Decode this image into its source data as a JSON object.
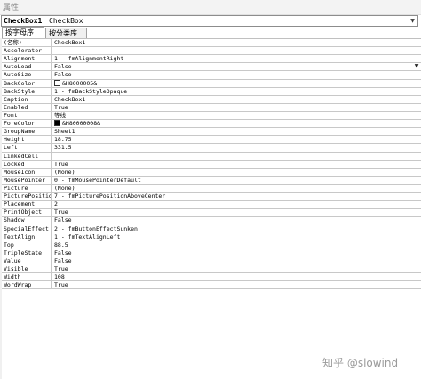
{
  "window": {
    "title": "属性"
  },
  "object_selector": {
    "name": "CheckBox1",
    "type": "CheckBox"
  },
  "tabs": [
    {
      "label": "按字母序",
      "active": true
    },
    {
      "label": "按分类序",
      "active": false
    }
  ],
  "properties": [
    {
      "name": "(名称)",
      "value": "CheckBox1"
    },
    {
      "name": "Accelerator",
      "value": ""
    },
    {
      "name": "Alignment",
      "value": "1 - fmAlignmentRight"
    },
    {
      "name": "AutoLoad",
      "value": "False",
      "selected": true
    },
    {
      "name": "AutoSize",
      "value": "False"
    },
    {
      "name": "BackColor",
      "value": "&H8000005&",
      "swatch": "#ffffff"
    },
    {
      "name": "BackStyle",
      "value": "1 - fmBackStyleOpaque"
    },
    {
      "name": "Caption",
      "value": "CheckBox1"
    },
    {
      "name": "Enabled",
      "value": "True"
    },
    {
      "name": "Font",
      "value": "等线"
    },
    {
      "name": "ForeColor",
      "value": "&H80000008&",
      "swatch": "#000000"
    },
    {
      "name": "GroupName",
      "value": "Sheet1"
    },
    {
      "name": "Height",
      "value": "18.75"
    },
    {
      "name": "Left",
      "value": "331.5"
    },
    {
      "name": "LinkedCell",
      "value": ""
    },
    {
      "name": "Locked",
      "value": "True"
    },
    {
      "name": "MouseIcon",
      "value": "(None)"
    },
    {
      "name": "MousePointer",
      "value": "0 - fmMousePointerDefault"
    },
    {
      "name": "Picture",
      "value": "(None)"
    },
    {
      "name": "PicturePosition",
      "value": "7 - fmPicturePositionAboveCenter"
    },
    {
      "name": "Placement",
      "value": "2"
    },
    {
      "name": "PrintObject",
      "value": "True"
    },
    {
      "name": "Shadow",
      "value": "False"
    },
    {
      "name": "SpecialEffect",
      "value": "2 - fmButtonEffectSunken"
    },
    {
      "name": "TextAlign",
      "value": "1 - fmTextAlignLeft"
    },
    {
      "name": "Top",
      "value": "88.5"
    },
    {
      "name": "TripleState",
      "value": "False"
    },
    {
      "name": "Value",
      "value": "False"
    },
    {
      "name": "Visible",
      "value": "True"
    },
    {
      "name": "Width",
      "value": "108"
    },
    {
      "name": "WordWrap",
      "value": "True"
    }
  ],
  "watermark": "知乎 @slowind"
}
